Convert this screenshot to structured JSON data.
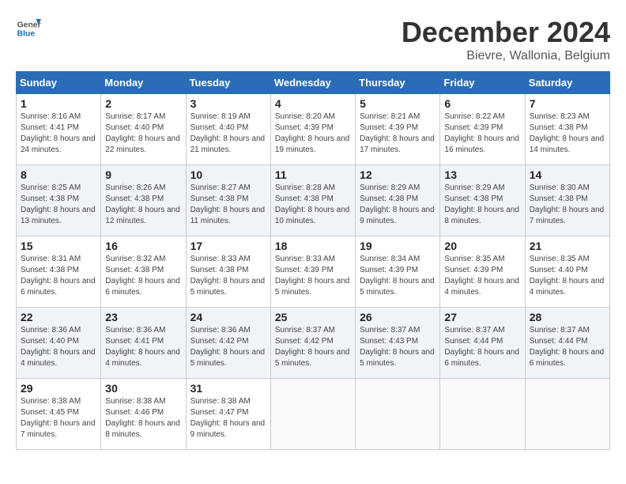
{
  "header": {
    "logo": {
      "general": "General",
      "blue": "Blue"
    },
    "title": "December 2024",
    "subtitle": "Bievre, Wallonia, Belgium"
  },
  "weekdays": [
    "Sunday",
    "Monday",
    "Tuesday",
    "Wednesday",
    "Thursday",
    "Friday",
    "Saturday"
  ],
  "weeks": [
    [
      {
        "day": "1",
        "sunrise": "8:16 AM",
        "sunset": "4:41 PM",
        "daylight": "8 hours and 24 minutes."
      },
      {
        "day": "2",
        "sunrise": "8:17 AM",
        "sunset": "4:40 PM",
        "daylight": "8 hours and 22 minutes."
      },
      {
        "day": "3",
        "sunrise": "8:19 AM",
        "sunset": "4:40 PM",
        "daylight": "8 hours and 21 minutes."
      },
      {
        "day": "4",
        "sunrise": "8:20 AM",
        "sunset": "4:39 PM",
        "daylight": "8 hours and 19 minutes."
      },
      {
        "day": "5",
        "sunrise": "8:21 AM",
        "sunset": "4:39 PM",
        "daylight": "8 hours and 17 minutes."
      },
      {
        "day": "6",
        "sunrise": "8:22 AM",
        "sunset": "4:39 PM",
        "daylight": "8 hours and 16 minutes."
      },
      {
        "day": "7",
        "sunrise": "8:23 AM",
        "sunset": "4:38 PM",
        "daylight": "8 hours and 14 minutes."
      }
    ],
    [
      {
        "day": "8",
        "sunrise": "8:25 AM",
        "sunset": "4:38 PM",
        "daylight": "8 hours and 13 minutes."
      },
      {
        "day": "9",
        "sunrise": "8:26 AM",
        "sunset": "4:38 PM",
        "daylight": "8 hours and 12 minutes."
      },
      {
        "day": "10",
        "sunrise": "8:27 AM",
        "sunset": "4:38 PM",
        "daylight": "8 hours and 11 minutes."
      },
      {
        "day": "11",
        "sunrise": "8:28 AM",
        "sunset": "4:38 PM",
        "daylight": "8 hours and 10 minutes."
      },
      {
        "day": "12",
        "sunrise": "8:29 AM",
        "sunset": "4:38 PM",
        "daylight": "8 hours and 9 minutes."
      },
      {
        "day": "13",
        "sunrise": "8:29 AM",
        "sunset": "4:38 PM",
        "daylight": "8 hours and 8 minutes."
      },
      {
        "day": "14",
        "sunrise": "8:30 AM",
        "sunset": "4:38 PM",
        "daylight": "8 hours and 7 minutes."
      }
    ],
    [
      {
        "day": "15",
        "sunrise": "8:31 AM",
        "sunset": "4:38 PM",
        "daylight": "8 hours and 6 minutes."
      },
      {
        "day": "16",
        "sunrise": "8:32 AM",
        "sunset": "4:38 PM",
        "daylight": "8 hours and 6 minutes."
      },
      {
        "day": "17",
        "sunrise": "8:33 AM",
        "sunset": "4:38 PM",
        "daylight": "8 hours and 5 minutes."
      },
      {
        "day": "18",
        "sunrise": "8:33 AM",
        "sunset": "4:39 PM",
        "daylight": "8 hours and 5 minutes."
      },
      {
        "day": "19",
        "sunrise": "8:34 AM",
        "sunset": "4:39 PM",
        "daylight": "8 hours and 5 minutes."
      },
      {
        "day": "20",
        "sunrise": "8:35 AM",
        "sunset": "4:39 PM",
        "daylight": "8 hours and 4 minutes."
      },
      {
        "day": "21",
        "sunrise": "8:35 AM",
        "sunset": "4:40 PM",
        "daylight": "8 hours and 4 minutes."
      }
    ],
    [
      {
        "day": "22",
        "sunrise": "8:36 AM",
        "sunset": "4:40 PM",
        "daylight": "8 hours and 4 minutes."
      },
      {
        "day": "23",
        "sunrise": "8:36 AM",
        "sunset": "4:41 PM",
        "daylight": "8 hours and 4 minutes."
      },
      {
        "day": "24",
        "sunrise": "8:36 AM",
        "sunset": "4:42 PM",
        "daylight": "8 hours and 5 minutes."
      },
      {
        "day": "25",
        "sunrise": "8:37 AM",
        "sunset": "4:42 PM",
        "daylight": "8 hours and 5 minutes."
      },
      {
        "day": "26",
        "sunrise": "8:37 AM",
        "sunset": "4:43 PM",
        "daylight": "8 hours and 5 minutes."
      },
      {
        "day": "27",
        "sunrise": "8:37 AM",
        "sunset": "4:44 PM",
        "daylight": "8 hours and 6 minutes."
      },
      {
        "day": "28",
        "sunrise": "8:37 AM",
        "sunset": "4:44 PM",
        "daylight": "8 hours and 6 minutes."
      }
    ],
    [
      {
        "day": "29",
        "sunrise": "8:38 AM",
        "sunset": "4:45 PM",
        "daylight": "8 hours and 7 minutes."
      },
      {
        "day": "30",
        "sunrise": "8:38 AM",
        "sunset": "4:46 PM",
        "daylight": "8 hours and 8 minutes."
      },
      {
        "day": "31",
        "sunrise": "8:38 AM",
        "sunset": "4:47 PM",
        "daylight": "8 hours and 9 minutes."
      },
      null,
      null,
      null,
      null
    ]
  ]
}
